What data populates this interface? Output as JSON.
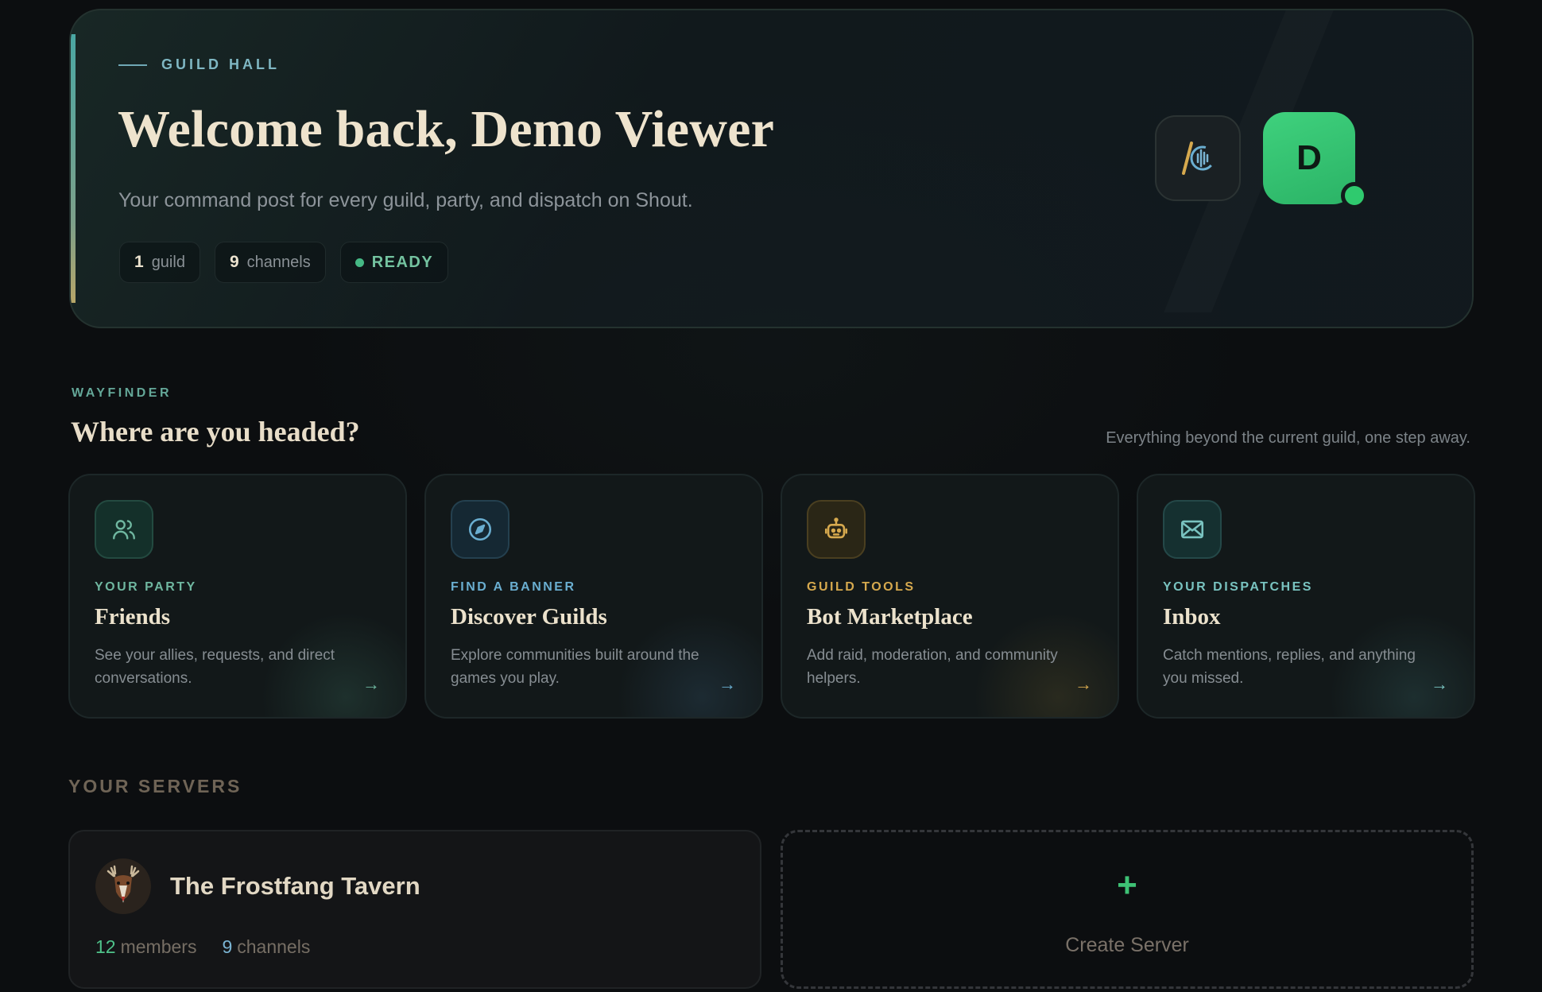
{
  "hero": {
    "eyebrow": "GUILD HALL",
    "title": "Welcome back, Demo Viewer",
    "subtitle": "Your command post for every guild, party, and dispatch on Shout.",
    "chips": [
      {
        "value": "1",
        "label": "guild"
      },
      {
        "value": "9",
        "label": "channels"
      }
    ],
    "status": "READY",
    "avatar_initial": "D",
    "brand_icon": "shout-logo-icon"
  },
  "wayfinder": {
    "eyebrow": "WAYFINDER",
    "title": "Where are you headed?",
    "aside": "Everything beyond the current guild, one step away.",
    "cards": [
      {
        "kicker": "YOUR PARTY",
        "title": "Friends",
        "desc": "See your allies, requests, and direct conversations.",
        "icon": "users-icon",
        "accent": "#6fb7a0"
      },
      {
        "kicker": "FIND A BANNER",
        "title": "Discover Guilds",
        "desc": "Explore communities built around the games you play.",
        "icon": "compass-icon",
        "accent": "#6aaed0"
      },
      {
        "kicker": "GUILD TOOLS",
        "title": "Bot Marketplace",
        "desc": "Add raid, moderation, and community helpers.",
        "icon": "robot-icon",
        "accent": "#d6a94e"
      },
      {
        "kicker": "YOUR DISPATCHES",
        "title": "Inbox",
        "desc": "Catch mentions, replies, and anything you missed.",
        "icon": "mail-icon",
        "accent": "#79c3c0"
      }
    ]
  },
  "servers": {
    "heading": "YOUR SERVERS",
    "items": [
      {
        "name": "The Frostfang Tavern",
        "members": "12",
        "members_label": "members",
        "channels": "9",
        "channels_label": "channels",
        "icon": "stag-avatar-icon"
      }
    ],
    "create_label": "Create Server",
    "create_icon": "+"
  }
}
